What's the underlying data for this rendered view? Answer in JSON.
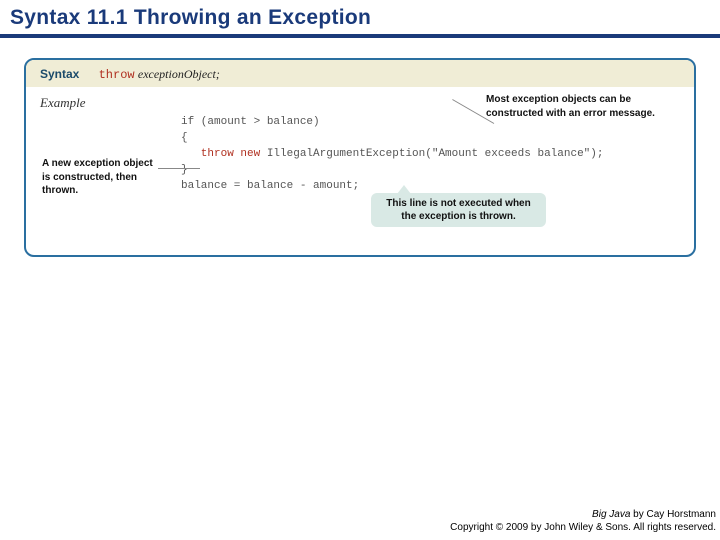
{
  "title": "Syntax 11.1 Throwing an Exception",
  "syntax": {
    "label": "Syntax",
    "keyword": "throw",
    "object": "exceptionObject",
    "semicolon": ";"
  },
  "example": {
    "label": "Example",
    "code": {
      "l1": "if (amount > balance)",
      "l2": "{",
      "l3_kw": "   throw new",
      "l3_rest": " IllegalArgumentException(\"Amount exceeds balance\");",
      "l4": "}",
      "l5": "balance = balance - amount;"
    }
  },
  "annotations": {
    "left": "A new exception object is constructed, then thrown.",
    "top": "Most exception objects can be constructed with an error message.",
    "bubble": "This line is not executed when the exception is thrown."
  },
  "footer": {
    "l1_title": "Big Java",
    "l1_rest": " by Cay Horstmann",
    "l2": "Copyright © 2009 by John Wiley & Sons.  All rights reserved."
  }
}
